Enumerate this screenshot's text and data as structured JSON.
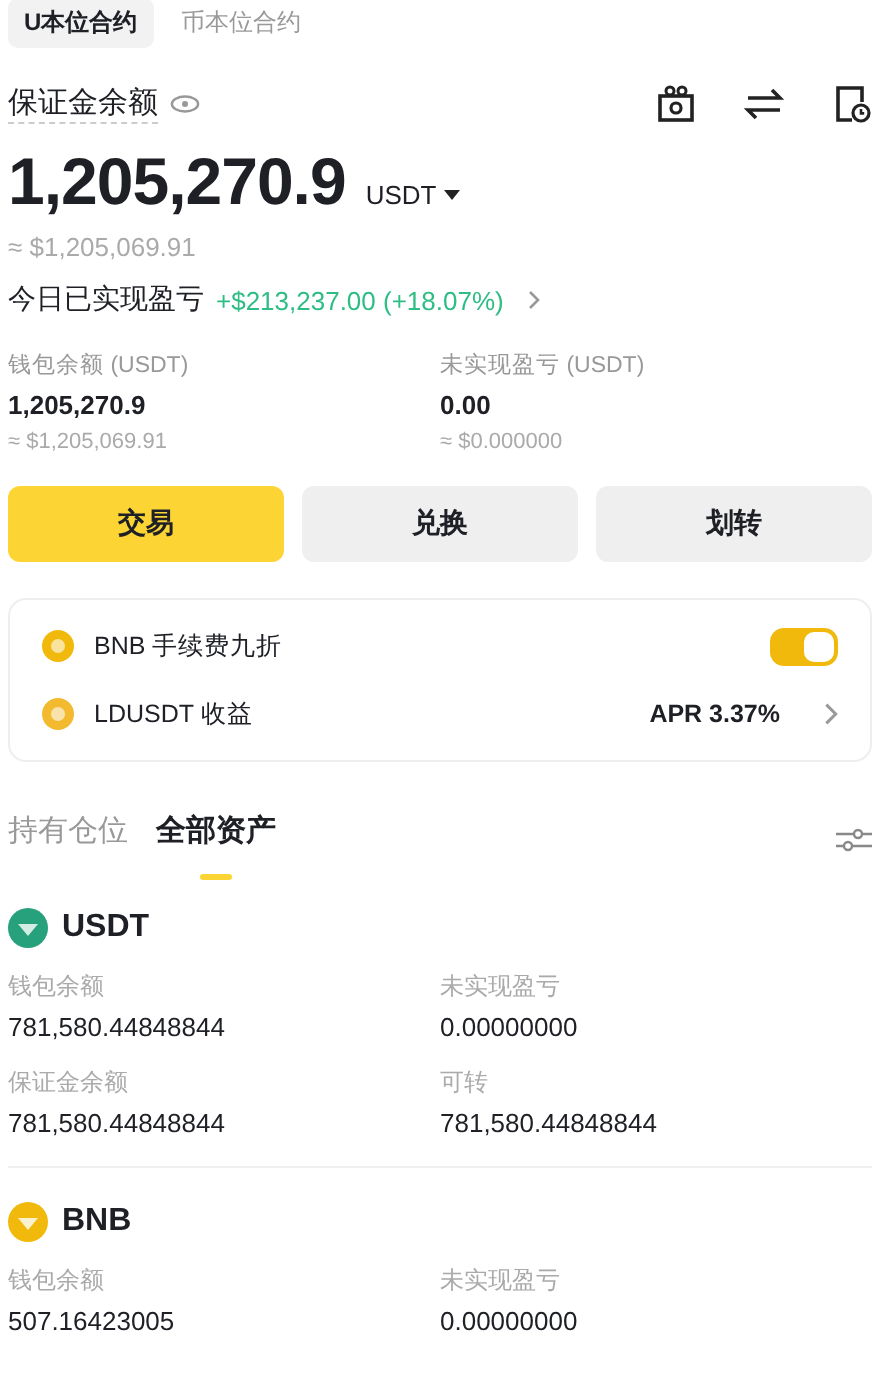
{
  "top_tabs": [
    {
      "label": "U本位合约",
      "selected": true
    },
    {
      "label": "币本位合约",
      "selected": false
    }
  ],
  "balance": {
    "label": "保证金余额",
    "amount": "1,205,270.9",
    "unit": "USDT",
    "approx": "≈ $1,205,069.91"
  },
  "today_pnl": {
    "label": "今日已实现盈亏",
    "value": "+$213,237.00 (+18.07%)"
  },
  "stats": [
    {
      "label": "钱包余额 (USDT)",
      "value": "1,205,270.9",
      "approx": "≈ $1,205,069.91"
    },
    {
      "label": "未实现盈亏 (USDT)",
      "value": "0.00",
      "approx": "≈ $0.000000"
    }
  ],
  "actions": [
    {
      "label": "交易",
      "primary": true
    },
    {
      "label": "兑换",
      "primary": false
    },
    {
      "label": "划转",
      "primary": false
    }
  ],
  "options": [
    {
      "kind": "toggle",
      "color": "#f0b90b",
      "label": "BNB 手续费九折",
      "on": true
    },
    {
      "kind": "link",
      "color": "#f3ba2f",
      "label": "LDUSDT 收益",
      "value": "APR 3.37%"
    }
  ],
  "asset_tabs": [
    {
      "label": "持有仓位",
      "selected": false
    },
    {
      "label": "全部资产",
      "selected": true
    }
  ],
  "assets": [
    {
      "color": "#26a17b",
      "name": "USDT",
      "fields": [
        {
          "label": "钱包余额",
          "value": "781,580.44848844"
        },
        {
          "label": "未实现盈亏",
          "value": "0.00000000"
        },
        {
          "label": "保证金余额",
          "value": "781,580.44848844"
        },
        {
          "label": "可转",
          "value": "781,580.44848844"
        }
      ]
    },
    {
      "color": "#f0b90b",
      "name": "BNB",
      "fields": [
        {
          "label": "钱包余额",
          "value": "507.16423005"
        },
        {
          "label": "未实现盈亏",
          "value": "0.00000000"
        }
      ]
    }
  ]
}
